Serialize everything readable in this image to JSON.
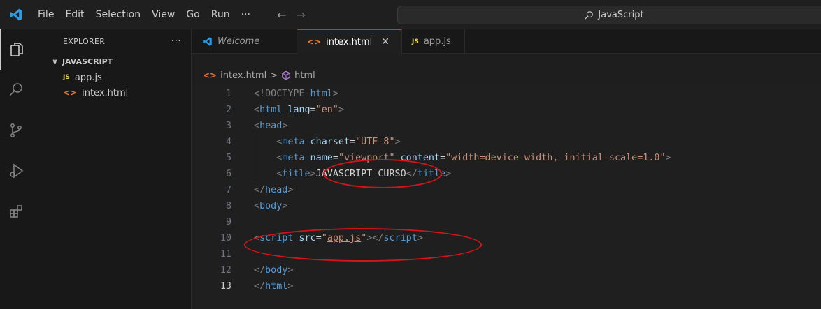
{
  "menu": [
    "File",
    "Edit",
    "Selection",
    "View",
    "Go",
    "Run",
    "···"
  ],
  "search": {
    "text": "JavaScript"
  },
  "explorer": {
    "title": "EXPLORER",
    "more": "···",
    "folder": "JAVASCRIPT",
    "files": [
      {
        "badge": "JS",
        "name": "app.js"
      },
      {
        "badge": "<>",
        "name": "intex.html"
      }
    ]
  },
  "tabs": {
    "welcome": "Welcome",
    "active": "intex.html",
    "active_close": "✕",
    "app": "app.js",
    "js_badge": "JS",
    "html_badge": "<>"
  },
  "breadcrumb": {
    "file": "intex.html",
    "sep": ">",
    "node": "html"
  },
  "editor": {
    "current_line": 13,
    "line_numbers": [
      "1",
      "2",
      "3",
      "4",
      "5",
      "6",
      "7",
      "8",
      "9",
      "10",
      "11",
      "12",
      "13"
    ]
  },
  "accent": {
    "annotation": "#d4141b",
    "js": "#e8d44d",
    "html": "#e37933",
    "vscode_blue": "#0078d4"
  }
}
